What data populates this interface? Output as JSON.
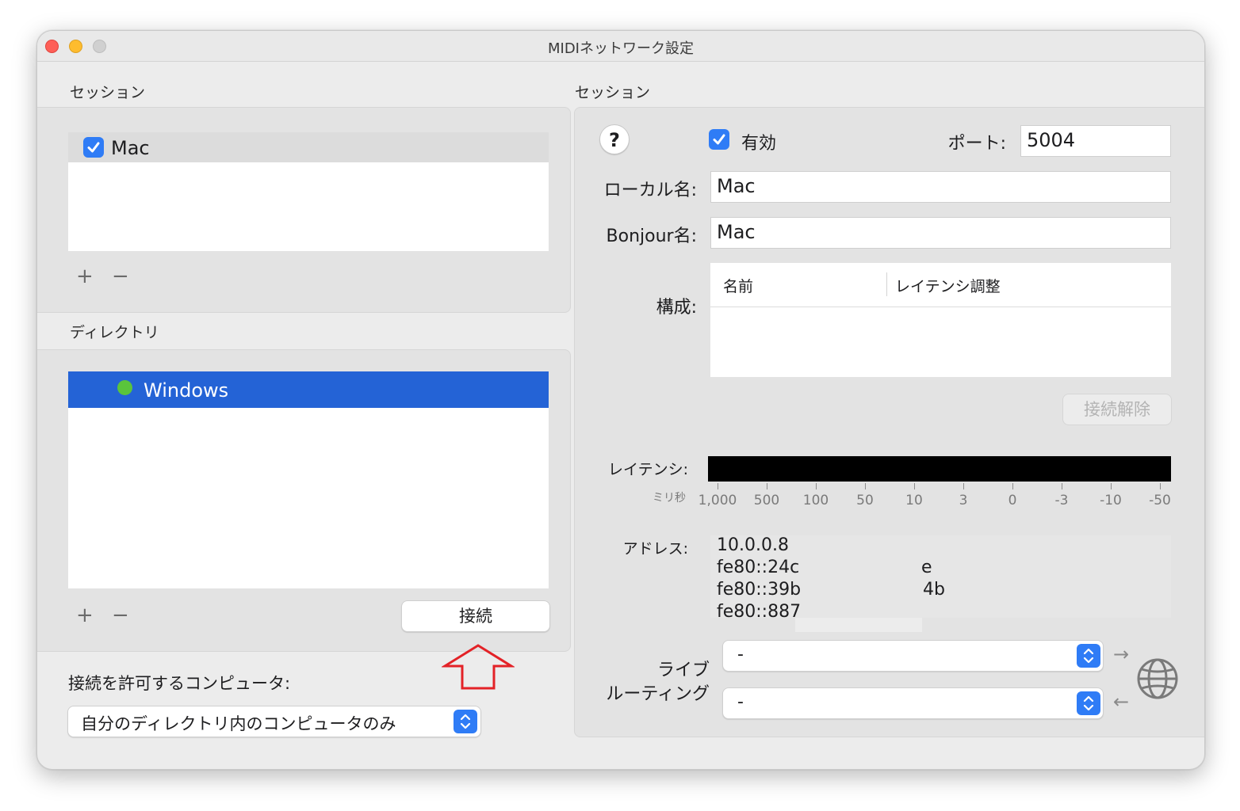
{
  "window": {
    "title": "MIDIネットワーク設定"
  },
  "sessions_panel": {
    "label": "セッション",
    "items": [
      {
        "name": "Mac",
        "checked": true
      }
    ],
    "add": "+",
    "remove": "−"
  },
  "directory_panel": {
    "label": "ディレクトリ",
    "items": [
      {
        "name": "Windows",
        "status_color": "#5ac43c",
        "selected": true
      }
    ],
    "add": "+",
    "remove": "−",
    "connect_label": "接続"
  },
  "allow": {
    "label": "接続を許可するコンピュータ:",
    "selected": "自分のディレクトリ内のコンピュータのみ"
  },
  "session_detail": {
    "label": "セッション",
    "help": "?",
    "enabled_label": "有効",
    "enabled": true,
    "port_label": "ポート:",
    "port_value": "5004",
    "local_name_label": "ローカル名:",
    "local_name_value": "Mac",
    "bonjour_label": "Bonjour名:",
    "bonjour_value": "Mac",
    "config_label": "構成:",
    "config_columns": [
      "名前",
      "レイテンシ調整"
    ],
    "disconnect_label": "接続解除",
    "latency_label": "レイテンシ:",
    "latency_unit": "ミリ秒",
    "latency_ticks": [
      "1,000",
      "500",
      "100",
      "50",
      "10",
      "3",
      "0",
      "-3",
      "-10",
      "-50"
    ],
    "address_label": "アドレス:",
    "addresses": [
      "10.0.0.8",
      "fe80::24c",
      "fe80::39b",
      "fe80::887"
    ],
    "address_suffixes": [
      "",
      "e",
      "4b",
      ""
    ],
    "live_routing_label_1": "ライブ",
    "live_routing_label_2": "ルーティング",
    "routing_in_value": "-",
    "routing_out_value": "-",
    "arrow_right": "→",
    "arrow_left": "←"
  },
  "colors": {
    "accent": "#2f7cf6",
    "selection": "#2463d6",
    "annotation_arrow": "#e32227"
  },
  "icons": [
    "checkbox-checked-icon",
    "status-dot-icon",
    "updown-chevron-icon",
    "globe-network-icon",
    "help-icon",
    "up-arrow-annotation-icon"
  ]
}
